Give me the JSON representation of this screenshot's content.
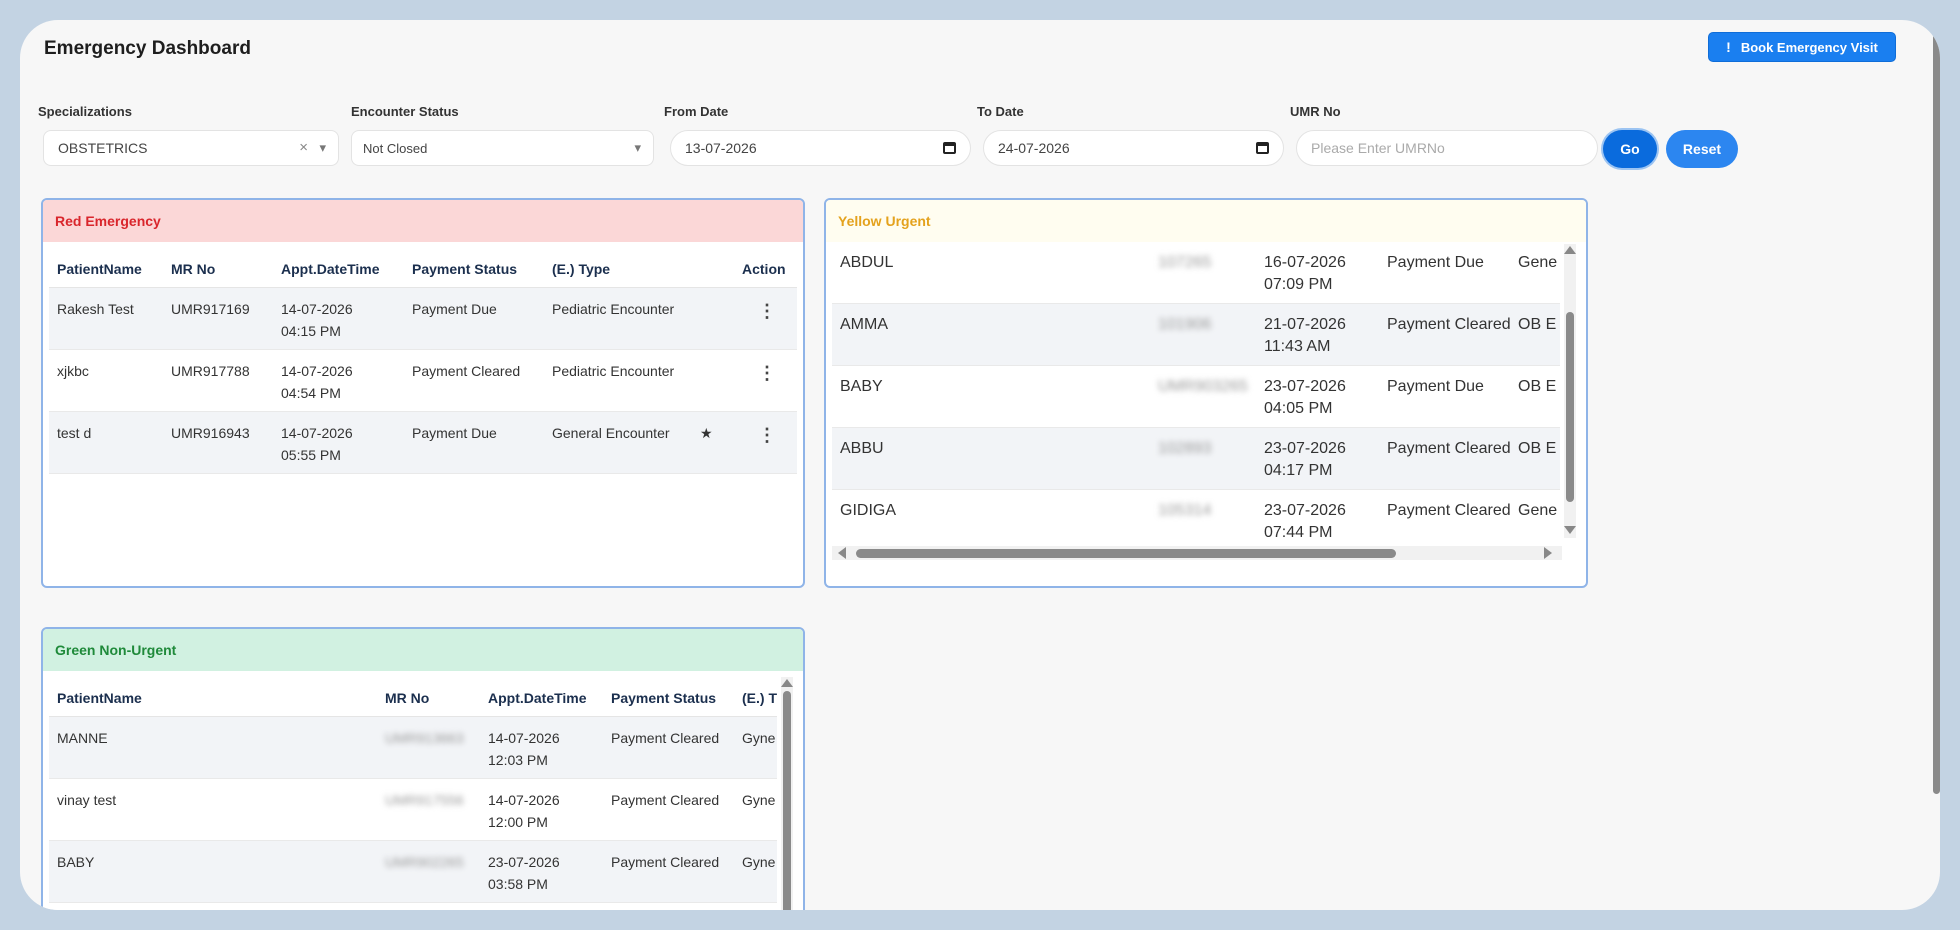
{
  "header": {
    "title": "Emergency Dashboard",
    "book_button": "Book Emergency Visit",
    "book_icon": "!"
  },
  "filters": {
    "specializations": {
      "label": "Specializations",
      "value": "OBSTETRICS",
      "clear": "×",
      "caret": "▾"
    },
    "encounter_status": {
      "label": "Encounter Status",
      "value": "Not Closed",
      "caret": "▾"
    },
    "from_date": {
      "label": "From Date",
      "value": "13-07-2026"
    },
    "to_date": {
      "label": "To Date",
      "value": "24-07-2026"
    },
    "umr": {
      "label": "UMR No",
      "placeholder": "Please Enter UMRNo"
    },
    "go_button": "Go",
    "reset_button": "Reset"
  },
  "red": {
    "title": "Red Emergency",
    "columns": [
      "PatientName",
      "MR No",
      "Appt.DateTime",
      "Payment Status",
      "(E.) Type",
      "Action"
    ],
    "rows": [
      {
        "name": "Rakesh Test",
        "mr": "UMR917169",
        "date": "14-07-2026",
        "time": "04:15 PM",
        "payment": "Payment Due",
        "type": "Pediatric Encounter",
        "star": ""
      },
      {
        "name": "xjkbc",
        "mr": "UMR917788",
        "date": "14-07-2026",
        "time": "04:54 PM",
        "payment": "Payment Cleared",
        "type": "Pediatric Encounter",
        "star": ""
      },
      {
        "name": "test d",
        "mr": "UMR916943",
        "date": "14-07-2026",
        "time": "05:55 PM",
        "payment": "Payment Due",
        "type": "General Encounter",
        "star": "★"
      }
    ],
    "action_icon": "⋮"
  },
  "yellow": {
    "title": "Yellow Urgent",
    "rows": [
      {
        "name": "ABDUL",
        "mr": "107265",
        "date": "16-07-2026",
        "time": "07:09 PM",
        "payment": "Payment Due",
        "type": "Gene"
      },
      {
        "name": "AMMA",
        "mr": "101906",
        "date": "21-07-2026",
        "time": "11:43 AM",
        "payment": "Payment Cleared",
        "type": "OB E"
      },
      {
        "name": "BABY",
        "mr": "UMR903265",
        "date": "23-07-2026",
        "time": "04:05 PM",
        "payment": "Payment Due",
        "type": "OB E"
      },
      {
        "name": "ABBU",
        "mr": "102893",
        "date": "23-07-2026",
        "time": "04:17 PM",
        "payment": "Payment Cleared",
        "type": "OB E"
      },
      {
        "name": "GIDIGA",
        "mr": "105314",
        "date": "23-07-2026",
        "time": "07:44 PM",
        "payment": "Payment Cleared",
        "type": "Gene"
      }
    ]
  },
  "green": {
    "title": "Green Non-Urgent",
    "columns": [
      "PatientName",
      "MR No",
      "Appt.DateTime",
      "Payment Status",
      "(E.) T"
    ],
    "rows": [
      {
        "name": "MANNE",
        "mr": "UMR913663",
        "date": "14-07-2026",
        "time": "12:03 PM",
        "payment": "Payment Cleared",
        "type": "Gyne"
      },
      {
        "name": "vinay test",
        "mr": "UMR917556",
        "date": "14-07-2026",
        "time": "12:00 PM",
        "payment": "Payment Cleared",
        "type": "Gyne"
      },
      {
        "name": "BABY",
        "mr": "UMR902265",
        "date": "23-07-2026",
        "time": "03:58 PM",
        "payment": "Payment Cleared",
        "type": "Gyne"
      }
    ]
  }
}
